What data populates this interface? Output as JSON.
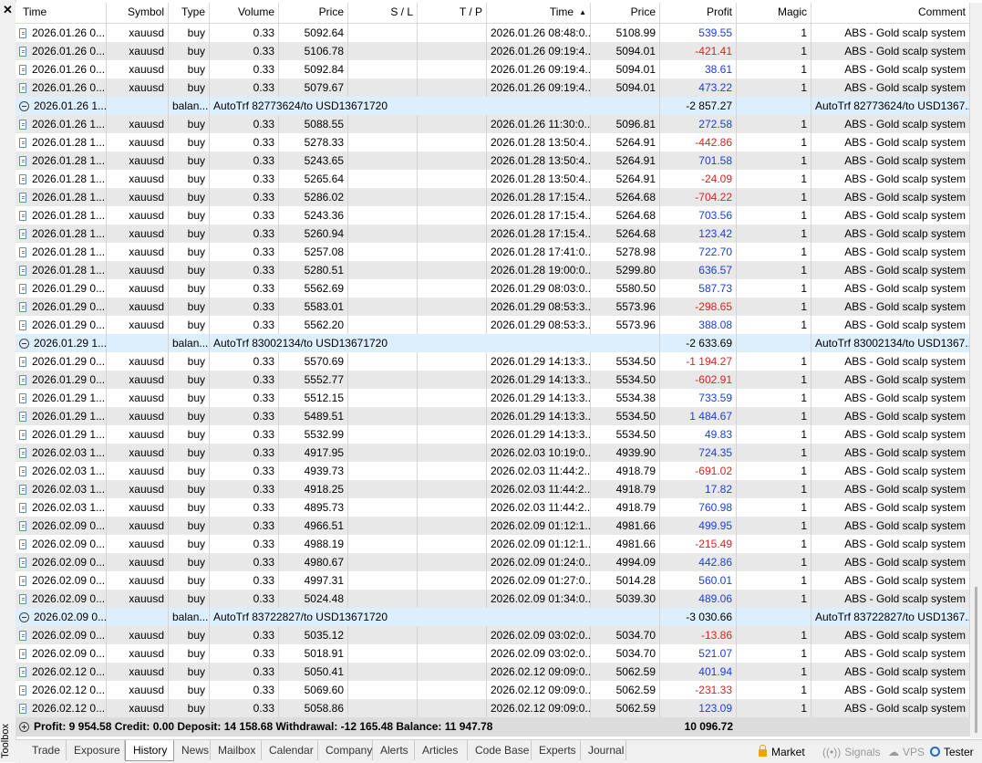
{
  "toolbox": {
    "close_glyph": "✕",
    "label": "Toolbox"
  },
  "columns": [
    "Time",
    "Symbol",
    "Type",
    "Volume",
    "Price",
    "S / L",
    "T / P",
    "Time",
    "Price",
    "Profit",
    "Magic",
    "Comment"
  ],
  "rows": [
    {
      "t": "d",
      "open": "2026.01.26 0...",
      "sym": "xauusd",
      "type": "buy",
      "vol": "0.33",
      "price": "5092.64",
      "close": "2026.01.26 08:48:0...",
      "cprice": "5108.99",
      "profit": "539.55",
      "sign": "pos",
      "magic": "1",
      "comment": "ABS - Gold scalp system"
    },
    {
      "t": "d",
      "open": "2026.01.26 0...",
      "sym": "xauusd",
      "type": "buy",
      "vol": "0.33",
      "price": "5106.78",
      "close": "2026.01.26 09:19:4...",
      "cprice": "5094.01",
      "profit": "-421.41",
      "sign": "neg",
      "magic": "1",
      "comment": "ABS - Gold scalp system"
    },
    {
      "t": "d",
      "open": "2026.01.26 0...",
      "sym": "xauusd",
      "type": "buy",
      "vol": "0.33",
      "price": "5092.84",
      "close": "2026.01.26 09:19:4...",
      "cprice": "5094.01",
      "profit": "38.61",
      "sign": "pos",
      "magic": "1",
      "comment": "ABS - Gold scalp system"
    },
    {
      "t": "d",
      "open": "2026.01.26 0...",
      "sym": "xauusd",
      "type": "buy",
      "vol": "0.33",
      "price": "5079.67",
      "close": "2026.01.26 09:19:4...",
      "cprice": "5094.01",
      "profit": "473.22",
      "sign": "pos",
      "magic": "1",
      "comment": "ABS - Gold scalp system"
    },
    {
      "t": "b",
      "open": "2026.01.26 1...",
      "type": "balan...",
      "desc": "AutoTrf 82773624/to USD13671720",
      "profit": "-2 857.27",
      "comment": "AutoTrf 82773624/to USD1367..."
    },
    {
      "t": "d",
      "open": "2026.01.26 1...",
      "sym": "xauusd",
      "type": "buy",
      "vol": "0.33",
      "price": "5088.55",
      "close": "2026.01.26 11:30:0...",
      "cprice": "5096.81",
      "profit": "272.58",
      "sign": "pos",
      "magic": "1",
      "comment": "ABS - Gold scalp system"
    },
    {
      "t": "d",
      "open": "2026.01.28 1...",
      "sym": "xauusd",
      "type": "buy",
      "vol": "0.33",
      "price": "5278.33",
      "close": "2026.01.28 13:50:4...",
      "cprice": "5264.91",
      "profit": "-442.86",
      "sign": "neg",
      "magic": "1",
      "comment": "ABS - Gold scalp system"
    },
    {
      "t": "d",
      "open": "2026.01.28 1...",
      "sym": "xauusd",
      "type": "buy",
      "vol": "0.33",
      "price": "5243.65",
      "close": "2026.01.28 13:50:4...",
      "cprice": "5264.91",
      "profit": "701.58",
      "sign": "pos",
      "magic": "1",
      "comment": "ABS - Gold scalp system"
    },
    {
      "t": "d",
      "open": "2026.01.28 1...",
      "sym": "xauusd",
      "type": "buy",
      "vol": "0.33",
      "price": "5265.64",
      "close": "2026.01.28 13:50:4...",
      "cprice": "5264.91",
      "profit": "-24.09",
      "sign": "neg",
      "magic": "1",
      "comment": "ABS - Gold scalp system"
    },
    {
      "t": "d",
      "open": "2026.01.28 1...",
      "sym": "xauusd",
      "type": "buy",
      "vol": "0.33",
      "price": "5286.02",
      "close": "2026.01.28 17:15:4...",
      "cprice": "5264.68",
      "profit": "-704.22",
      "sign": "neg",
      "magic": "1",
      "comment": "ABS - Gold scalp system"
    },
    {
      "t": "d",
      "open": "2026.01.28 1...",
      "sym": "xauusd",
      "type": "buy",
      "vol": "0.33",
      "price": "5243.36",
      "close": "2026.01.28 17:15:4...",
      "cprice": "5264.68",
      "profit": "703.56",
      "sign": "pos",
      "magic": "1",
      "comment": "ABS - Gold scalp system"
    },
    {
      "t": "d",
      "open": "2026.01.28 1...",
      "sym": "xauusd",
      "type": "buy",
      "vol": "0.33",
      "price": "5260.94",
      "close": "2026.01.28 17:15:4...",
      "cprice": "5264.68",
      "profit": "123.42",
      "sign": "pos",
      "magic": "1",
      "comment": "ABS - Gold scalp system"
    },
    {
      "t": "d",
      "open": "2026.01.28 1...",
      "sym": "xauusd",
      "type": "buy",
      "vol": "0.33",
      "price": "5257.08",
      "close": "2026.01.28 17:41:0...",
      "cprice": "5278.98",
      "profit": "722.70",
      "sign": "pos",
      "magic": "1",
      "comment": "ABS - Gold scalp system"
    },
    {
      "t": "d",
      "open": "2026.01.28 1...",
      "sym": "xauusd",
      "type": "buy",
      "vol": "0.33",
      "price": "5280.51",
      "close": "2026.01.28 19:00:0...",
      "cprice": "5299.80",
      "profit": "636.57",
      "sign": "pos",
      "magic": "1",
      "comment": "ABS - Gold scalp system"
    },
    {
      "t": "d",
      "open": "2026.01.29 0...",
      "sym": "xauusd",
      "type": "buy",
      "vol": "0.33",
      "price": "5562.69",
      "close": "2026.01.29 08:03:0...",
      "cprice": "5580.50",
      "profit": "587.73",
      "sign": "pos",
      "magic": "1",
      "comment": "ABS - Gold scalp system"
    },
    {
      "t": "d",
      "open": "2026.01.29 0...",
      "sym": "xauusd",
      "type": "buy",
      "vol": "0.33",
      "price": "5583.01",
      "close": "2026.01.29 08:53:3...",
      "cprice": "5573.96",
      "profit": "-298.65",
      "sign": "neg",
      "magic": "1",
      "comment": "ABS - Gold scalp system"
    },
    {
      "t": "d",
      "open": "2026.01.29 0...",
      "sym": "xauusd",
      "type": "buy",
      "vol": "0.33",
      "price": "5562.20",
      "close": "2026.01.29 08:53:3...",
      "cprice": "5573.96",
      "profit": "388.08",
      "sign": "pos",
      "magic": "1",
      "comment": "ABS - Gold scalp system"
    },
    {
      "t": "b",
      "open": "2026.01.29 1...",
      "type": "balan...",
      "desc": "AutoTrf 83002134/to USD13671720",
      "profit": "-2 633.69",
      "comment": "AutoTrf 83002134/to USD1367..."
    },
    {
      "t": "d",
      "open": "2026.01.29 0...",
      "sym": "xauusd",
      "type": "buy",
      "vol": "0.33",
      "price": "5570.69",
      "close": "2026.01.29 14:13:3...",
      "cprice": "5534.50",
      "profit": "-1 194.27",
      "sign": "neg",
      "magic": "1",
      "comment": "ABS - Gold scalp system"
    },
    {
      "t": "d",
      "open": "2026.01.29 0...",
      "sym": "xauusd",
      "type": "buy",
      "vol": "0.33",
      "price": "5552.77",
      "close": "2026.01.29 14:13:3...",
      "cprice": "5534.50",
      "profit": "-602.91",
      "sign": "neg",
      "magic": "1",
      "comment": "ABS - Gold scalp system"
    },
    {
      "t": "d",
      "open": "2026.01.29 1...",
      "sym": "xauusd",
      "type": "buy",
      "vol": "0.33",
      "price": "5512.15",
      "close": "2026.01.29 14:13:3...",
      "cprice": "5534.38",
      "profit": "733.59",
      "sign": "pos",
      "magic": "1",
      "comment": "ABS - Gold scalp system"
    },
    {
      "t": "d",
      "open": "2026.01.29 1...",
      "sym": "xauusd",
      "type": "buy",
      "vol": "0.33",
      "price": "5489.51",
      "close": "2026.01.29 14:13:3...",
      "cprice": "5534.50",
      "profit": "1 484.67",
      "sign": "pos",
      "magic": "1",
      "comment": "ABS - Gold scalp system"
    },
    {
      "t": "d",
      "open": "2026.01.29 1...",
      "sym": "xauusd",
      "type": "buy",
      "vol": "0.33",
      "price": "5532.99",
      "close": "2026.01.29 14:13:3...",
      "cprice": "5534.50",
      "profit": "49.83",
      "sign": "pos",
      "magic": "1",
      "comment": "ABS - Gold scalp system"
    },
    {
      "t": "d",
      "open": "2026.02.03 1...",
      "sym": "xauusd",
      "type": "buy",
      "vol": "0.33",
      "price": "4917.95",
      "close": "2026.02.03 10:19:0...",
      "cprice": "4939.90",
      "profit": "724.35",
      "sign": "pos",
      "magic": "1",
      "comment": "ABS - Gold scalp system"
    },
    {
      "t": "d",
      "open": "2026.02.03 1...",
      "sym": "xauusd",
      "type": "buy",
      "vol": "0.33",
      "price": "4939.73",
      "close": "2026.02.03 11:44:2...",
      "cprice": "4918.79",
      "profit": "-691.02",
      "sign": "neg",
      "magic": "1",
      "comment": "ABS - Gold scalp system"
    },
    {
      "t": "d",
      "open": "2026.02.03 1...",
      "sym": "xauusd",
      "type": "buy",
      "vol": "0.33",
      "price": "4918.25",
      "close": "2026.02.03 11:44:2...",
      "cprice": "4918.79",
      "profit": "17.82",
      "sign": "pos",
      "magic": "1",
      "comment": "ABS - Gold scalp system"
    },
    {
      "t": "d",
      "open": "2026.02.03 1...",
      "sym": "xauusd",
      "type": "buy",
      "vol": "0.33",
      "price": "4895.73",
      "close": "2026.02.03 11:44:2...",
      "cprice": "4918.79",
      "profit": "760.98",
      "sign": "pos",
      "magic": "1",
      "comment": "ABS - Gold scalp system"
    },
    {
      "t": "d",
      "open": "2026.02.09 0...",
      "sym": "xauusd",
      "type": "buy",
      "vol": "0.33",
      "price": "4966.51",
      "close": "2026.02.09 01:12:1...",
      "cprice": "4981.66",
      "profit": "499.95",
      "sign": "pos",
      "magic": "1",
      "comment": "ABS - Gold scalp system"
    },
    {
      "t": "d",
      "open": "2026.02.09 0...",
      "sym": "xauusd",
      "type": "buy",
      "vol": "0.33",
      "price": "4988.19",
      "close": "2026.02.09 01:12:1...",
      "cprice": "4981.66",
      "profit": "-215.49",
      "sign": "neg",
      "magic": "1",
      "comment": "ABS - Gold scalp system"
    },
    {
      "t": "d",
      "open": "2026.02.09 0...",
      "sym": "xauusd",
      "type": "buy",
      "vol": "0.33",
      "price": "4980.67",
      "close": "2026.02.09 01:24:0...",
      "cprice": "4994.09",
      "profit": "442.86",
      "sign": "pos",
      "magic": "1",
      "comment": "ABS - Gold scalp system"
    },
    {
      "t": "d",
      "open": "2026.02.09 0...",
      "sym": "xauusd",
      "type": "buy",
      "vol": "0.33",
      "price": "4997.31",
      "close": "2026.02.09 01:27:0...",
      "cprice": "5014.28",
      "profit": "560.01",
      "sign": "pos",
      "magic": "1",
      "comment": "ABS - Gold scalp system"
    },
    {
      "t": "d",
      "open": "2026.02.09 0...",
      "sym": "xauusd",
      "type": "buy",
      "vol": "0.33",
      "price": "5024.48",
      "close": "2026.02.09 01:34:0...",
      "cprice": "5039.30",
      "profit": "489.06",
      "sign": "pos",
      "magic": "1",
      "comment": "ABS - Gold scalp system"
    },
    {
      "t": "b",
      "open": "2026.02.09 0...",
      "type": "balan...",
      "desc": "AutoTrf 83722827/to USD13671720",
      "profit": "-3 030.66",
      "comment": "AutoTrf 83722827/to USD1367..."
    },
    {
      "t": "d",
      "open": "2026.02.09 0...",
      "sym": "xauusd",
      "type": "buy",
      "vol": "0.33",
      "price": "5035.12",
      "close": "2026.02.09 03:02:0...",
      "cprice": "5034.70",
      "profit": "-13.86",
      "sign": "neg",
      "magic": "1",
      "comment": "ABS - Gold scalp system"
    },
    {
      "t": "d",
      "open": "2026.02.09 0...",
      "sym": "xauusd",
      "type": "buy",
      "vol": "0.33",
      "price": "5018.91",
      "close": "2026.02.09 03:02:0...",
      "cprice": "5034.70",
      "profit": "521.07",
      "sign": "pos",
      "magic": "1",
      "comment": "ABS - Gold scalp system"
    },
    {
      "t": "d",
      "open": "2026.02.12 0...",
      "sym": "xauusd",
      "type": "buy",
      "vol": "0.33",
      "price": "5050.41",
      "close": "2026.02.12 09:09:0...",
      "cprice": "5062.59",
      "profit": "401.94",
      "sign": "pos",
      "magic": "1",
      "comment": "ABS - Gold scalp system"
    },
    {
      "t": "d",
      "open": "2026.02.12 0...",
      "sym": "xauusd",
      "type": "buy",
      "vol": "0.33",
      "price": "5069.60",
      "close": "2026.02.12 09:09:0...",
      "cprice": "5062.59",
      "profit": "-231.33",
      "sign": "neg",
      "magic": "1",
      "comment": "ABS - Gold scalp system"
    },
    {
      "t": "d",
      "open": "2026.02.12 0...",
      "sym": "xauusd",
      "type": "buy",
      "vol": "0.33",
      "price": "5058.86",
      "close": "2026.02.12 09:09:0...",
      "cprice": "5062.59",
      "profit": "123.09",
      "sign": "pos",
      "magic": "1",
      "comment": "ABS - Gold scalp system"
    }
  ],
  "summary": {
    "text": "Profit: 9 954.58  Credit: 0.00  Deposit: 14 158.68  Withdrawal: -12 165.48  Balance: 11 947.78",
    "profit_total": "10 096.72"
  },
  "tabs": [
    "Trade",
    "Exposure",
    "History",
    "News",
    "Mailbox",
    "Calendar",
    "Company",
    "Alerts",
    "Articles",
    "Code Base",
    "Experts",
    "Journal"
  ],
  "active_tab": "History",
  "right_tabs": {
    "market": "Market",
    "signals": "Signals",
    "vps": "VPS",
    "tester": "Tester"
  },
  "colors": {
    "positive": "#1a3de8",
    "negative": "#e02020",
    "balance_row": "#ddeefc",
    "alt_row": "#e8e8e8"
  }
}
